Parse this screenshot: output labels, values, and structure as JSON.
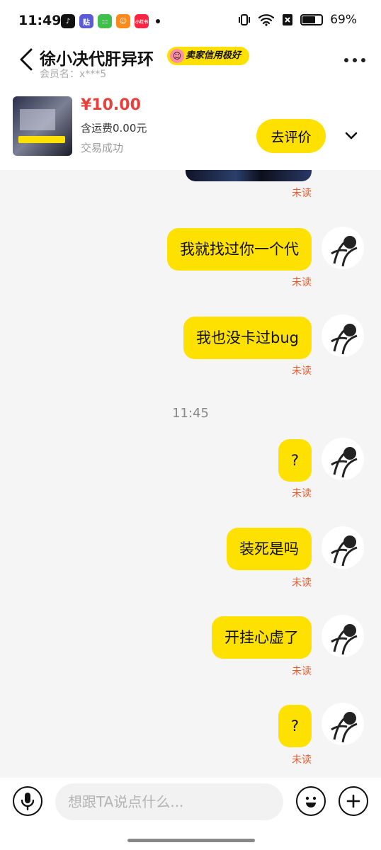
{
  "status": {
    "time": "11:49",
    "apps": [
      {
        "name": "tiktok-app-icon",
        "glyph": "♪",
        "color": "#111111"
      },
      {
        "name": "tieba-app-icon",
        "glyph": "贴",
        "color": "#5b5bd6"
      },
      {
        "name": "wechat-app-icon",
        "glyph": "⚏",
        "color": "#3ec04a"
      },
      {
        "name": "photo-app-icon",
        "glyph": "☺",
        "color": "#ff8a1a"
      },
      {
        "name": "xiaohongshu-app-icon",
        "glyph": "小红书",
        "color": "#ff2442"
      }
    ],
    "battery": "69%",
    "battery_level": 0.69
  },
  "header": {
    "title": "徐小决代肝异环",
    "badge": "卖家信用极好",
    "member": "会员名：x***5"
  },
  "product": {
    "price": "¥10.00",
    "shipping": "含运费0.00元",
    "status": "交易成功",
    "review_button": "去评价"
  },
  "chat": {
    "unread_label": "未读",
    "timestamp": "11:45",
    "messages": [
      {
        "text": "我就找过你一个代"
      },
      {
        "text": "我也没卡过bug"
      },
      {
        "text": "?"
      },
      {
        "text": "装死是吗"
      },
      {
        "text": "开挂心虚了"
      },
      {
        "text": "?"
      }
    ]
  },
  "input": {
    "placeholder": "想跟TA说点什么..."
  },
  "colors": {
    "accent": "#ffe100",
    "price": "#e8413b",
    "unread": "#e65a2b"
  }
}
